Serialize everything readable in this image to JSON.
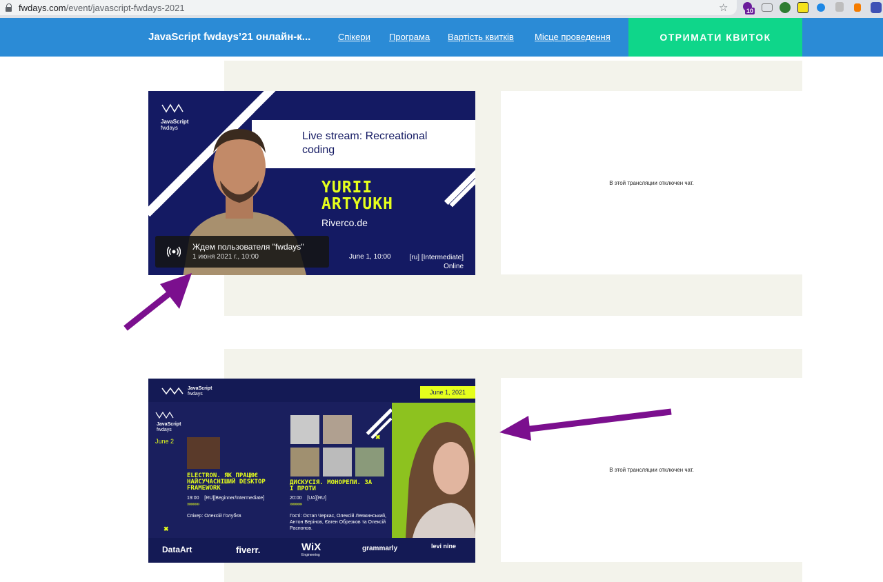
{
  "browser": {
    "url_domain": "fwdays.com",
    "url_path": "/event/javascript-fwdays-2021",
    "ext_badge": "10"
  },
  "header": {
    "title": "JavaScript fwdays’21 онлайн-к...",
    "nav": [
      "Спікери",
      "Програма",
      "Вартість квитків",
      "Місце проведення"
    ],
    "cta": "ОТРИМАТИ КВИТОК",
    "colors": {
      "bar": "#2b8bd6",
      "cta": "#0fd68a"
    }
  },
  "stream1": {
    "logo_line1": "JavaScript",
    "logo_line2": "fwdays",
    "banner_title": "Live stream: Recreational coding",
    "speaker_line1": "YURII",
    "speaker_line2": "ARTYUKH",
    "company": "Riverco.de",
    "date": "June 1, 10:00",
    "tags_line1": "[ru] [Intermediate]",
    "tags_line2": "Online",
    "overlay_title": "Ждем пользователя \"fwdays\"",
    "overlay_sub": "1 июня 2021 г., 10:00",
    "chat_disabled": "В этой трансляции отключен чат."
  },
  "stream2": {
    "header_logo_line1": "JavaScript",
    "header_logo_line2": "fwdays",
    "date_badge": "June 1, 2021",
    "logo_line1": "JavaScript",
    "logo_line2": "fwdays",
    "day_label": "June 2",
    "talk1": {
      "title": "ELECTRON. ЯК ПРАЦЮЄ НАЙСУЧАСНІШИЙ DESKTOP FRAMEWORK",
      "time_tags": "19:00    [RU][Beginner/Intermediate]",
      "speaker": "Спікер: Олексій Голубєв"
    },
    "talk2": {
      "title": "ДИСКУСІЯ. МОНОРЕПИ. ЗА І ПРОТИ",
      "time_tags": "20:00    [UA][RU]",
      "guests": "Гості: Остап Черкас, Олексій Левжинський, Антон Верінов, Євген Обрезков та Олексій Распопов."
    },
    "sponsors": [
      "DataArt",
      "fiverr.",
      "WiX",
      "grammarly",
      "levi nine"
    ],
    "wix_sub": "Engineering",
    "chat_disabled": "В этой трансляции отключен чат."
  },
  "annotation_color": "#7b0f8e"
}
